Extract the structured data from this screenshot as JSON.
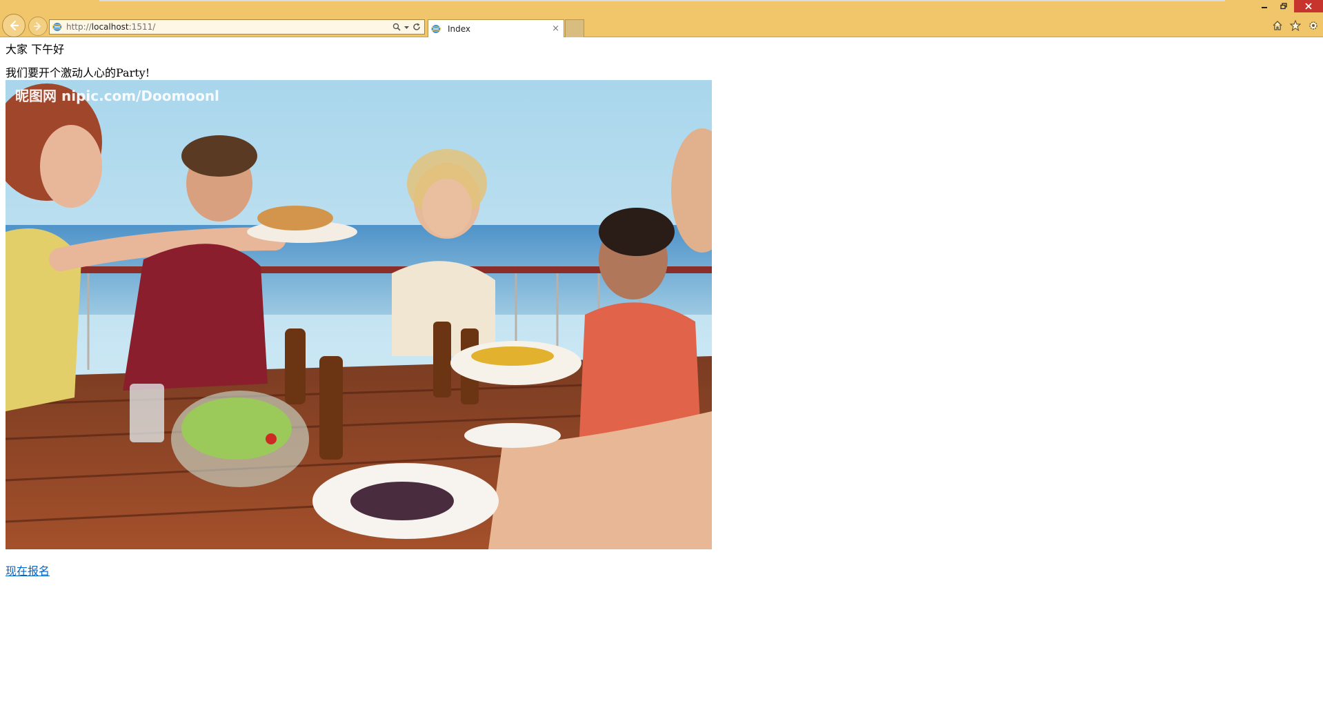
{
  "browser": {
    "url_prefix": "http://",
    "url_host": "localhost",
    "url_suffix": ":1511/",
    "tab_title": "Index",
    "tab_close": "×",
    "chrome_color": "#f1c66b"
  },
  "window_controls": {
    "minimize": "minimize-icon",
    "restore": "restore-icon",
    "close": "close-icon"
  },
  "toolbar_icons": [
    "home-icon",
    "star-icon",
    "gear-icon"
  ],
  "page": {
    "greeting": "大家 下午好",
    "announcement": "我们要开个激动人心的Party!",
    "photo_watermark": "昵图网 nipic.com/Doomoonl",
    "signup_link": "现在报名",
    "link_color": "#0066cc"
  }
}
